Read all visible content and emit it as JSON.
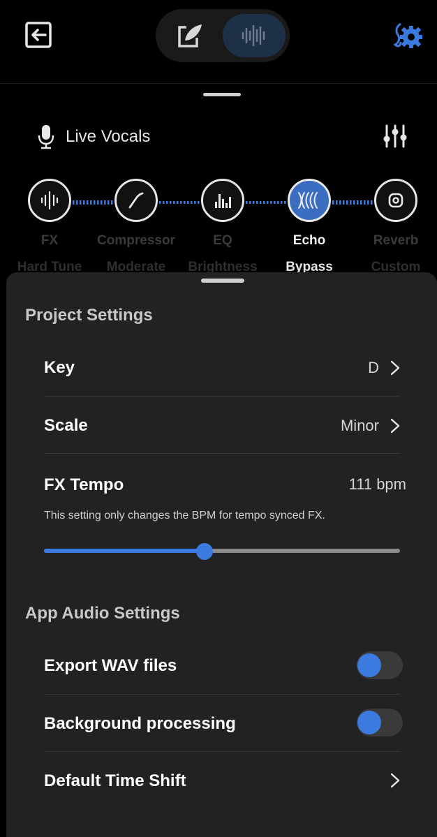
{
  "header": {
    "exit_icon": "exit-icon",
    "mode_edit_icon": "edit-icon",
    "mode_waveform_icon": "waveform-icon",
    "settings_icon": "music-settings-icon",
    "accent": "#3b7be0"
  },
  "track": {
    "name": "Live Vocals",
    "mic_icon": "microphone-icon",
    "mixer_icon": "mixer-icon"
  },
  "fx_chain": [
    {
      "label": "FX",
      "preset": "Hard Tune",
      "icon": "fx-icon",
      "active": false
    },
    {
      "label": "Compressor",
      "preset": "Moderate",
      "icon": "compressor-icon",
      "active": false
    },
    {
      "label": "EQ",
      "preset": "Brightness",
      "icon": "eq-icon",
      "active": false
    },
    {
      "label": "Echo",
      "preset": "Bypass",
      "icon": "echo-icon",
      "active": true
    },
    {
      "label": "Reverb",
      "preset": "Custom",
      "icon": "reverb-icon",
      "active": false
    }
  ],
  "project_settings": {
    "title": "Project Settings",
    "key": {
      "label": "Key",
      "value": "D"
    },
    "scale": {
      "label": "Scale",
      "value": "Minor"
    },
    "tempo": {
      "label": "FX Tempo",
      "value": "111 bpm",
      "description": "This setting only changes the BPM for tempo synced FX.",
      "slider_fraction": 0.45
    }
  },
  "app_audio_settings": {
    "title": "App Audio Settings",
    "export_wav": {
      "label": "Export WAV files",
      "enabled": false
    },
    "background_processing": {
      "label": "Background processing",
      "enabled": false
    },
    "default_time_shift": {
      "label": "Default Time Shift"
    }
  }
}
